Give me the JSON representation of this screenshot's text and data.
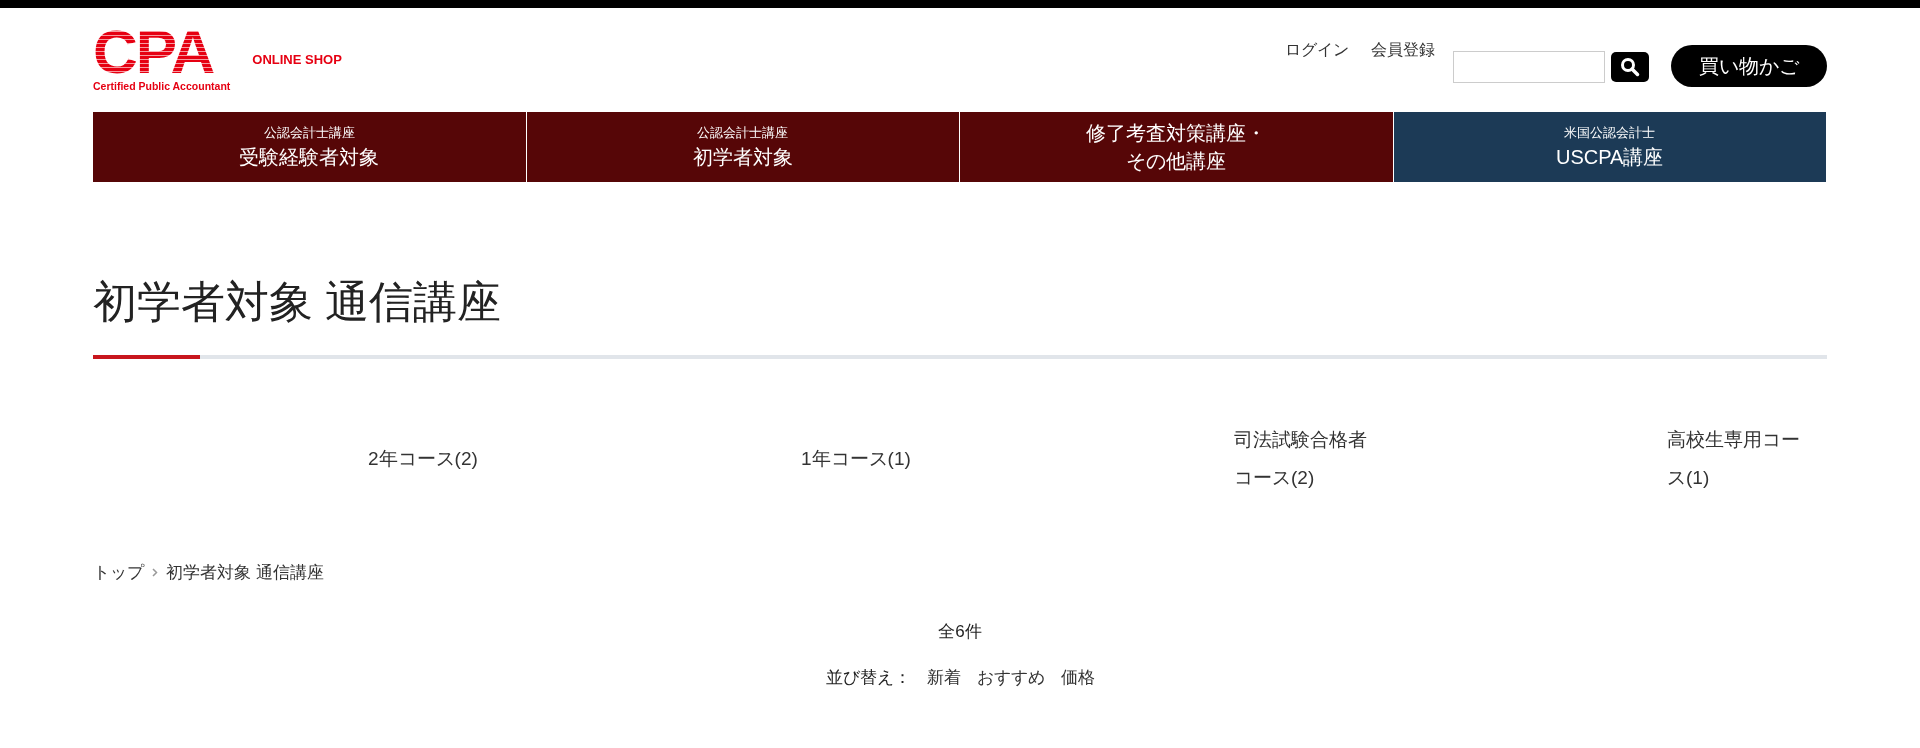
{
  "logo": {
    "mark": "CPA",
    "tagline": "Certified Public Accountant",
    "shop_label": "ONLINE SHOP"
  },
  "header_links": [
    "ログイン",
    "会員登録"
  ],
  "cart_button": "買い物かご",
  "nav": [
    {
      "subtitle": "公認会計士講座",
      "title": "受験経験者対象",
      "color": "#560607"
    },
    {
      "subtitle": "公認会計士講座",
      "title": "初学者対象",
      "color": "#560607"
    },
    {
      "title": "修了考査対策講座・その他講座",
      "color": "#560607"
    },
    {
      "subtitle": "米国公認会計士",
      "title": "USCPA講座",
      "color": "#1c3a56"
    }
  ],
  "page_title": "初学者対象 通信講座",
  "categories": [
    "2年コース(2)",
    "1年コース(1)",
    "司法試験合格者コース(2)",
    "高校生専用コース(1)"
  ],
  "breadcrumb": [
    "トップ",
    "初学者対象 通信講座"
  ],
  "result_count": "全6件",
  "sort": {
    "label": "並び替え：",
    "options": [
      "新着",
      "おすすめ",
      "価格"
    ]
  }
}
